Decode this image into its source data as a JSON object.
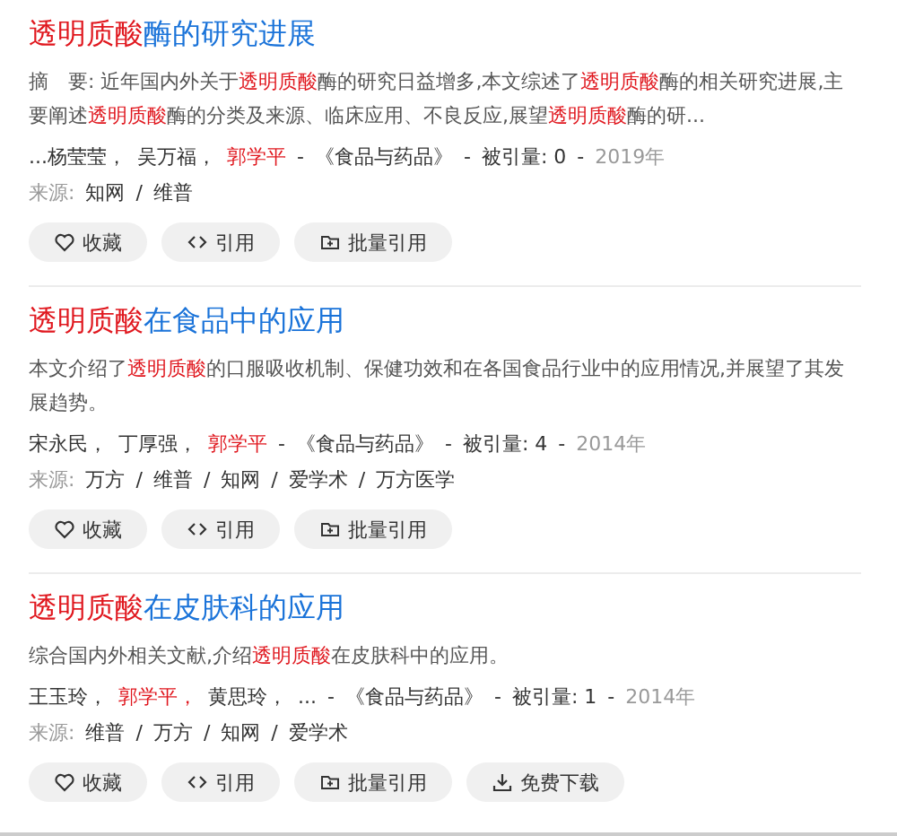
{
  "results": [
    {
      "title_highlight": "透明质酸",
      "title_rest": "酶的研究进展",
      "abstract": "摘　要: 近年国内外关于**透明质酸**酶的研究日益增多,本文综述了**透明质酸**酶的相关研究进展,主要阐述**透明质酸**酶的分类及来源、临床应用、不良反应,展望**透明质酸**酶的研...",
      "meta": [
        {
          "kind": "author",
          "text": "...杨莹莹，",
          "highlighted": false
        },
        {
          "kind": "author",
          "text": "吴万福，",
          "highlighted": false
        },
        {
          "kind": "author",
          "text": "郭学平",
          "highlighted": true
        },
        {
          "kind": "sep",
          "text": "-"
        },
        {
          "kind": "journal",
          "text": "《食品与药品》"
        },
        {
          "kind": "sep",
          "text": "-"
        },
        {
          "kind": "cite",
          "text": "被引量: 0"
        },
        {
          "kind": "sep",
          "text": "-"
        },
        {
          "kind": "year",
          "text": "2019年"
        }
      ],
      "source_label": "来源:",
      "source_separator": "/",
      "sources": [
        "知网",
        "维普"
      ],
      "actions": [
        {
          "kind": "heart",
          "label": "收藏"
        },
        {
          "kind": "code",
          "label": "引用"
        },
        {
          "kind": "folder",
          "label": "批量引用"
        }
      ]
    },
    {
      "title_highlight": "透明质酸",
      "title_rest": "在食品中的应用",
      "abstract": "本文介绍了**透明质酸**的口服吸收机制、保健功效和在各国食品行业中的应用情况,并展望了其发展趋势。",
      "meta": [
        {
          "kind": "author",
          "text": "宋永民，",
          "highlighted": false
        },
        {
          "kind": "author",
          "text": "丁厚强，",
          "highlighted": false
        },
        {
          "kind": "author",
          "text": "郭学平",
          "highlighted": true
        },
        {
          "kind": "sep",
          "text": "-"
        },
        {
          "kind": "journal",
          "text": "《食品与药品》"
        },
        {
          "kind": "sep",
          "text": "-"
        },
        {
          "kind": "cite",
          "text": "被引量: 4"
        },
        {
          "kind": "sep",
          "text": "-"
        },
        {
          "kind": "year",
          "text": "2014年"
        }
      ],
      "source_label": "来源:",
      "source_separator": "/",
      "sources": [
        "万方",
        "维普",
        "知网",
        "爱学术",
        "万方医学"
      ],
      "actions": [
        {
          "kind": "heart",
          "label": "收藏"
        },
        {
          "kind": "code",
          "label": "引用"
        },
        {
          "kind": "folder",
          "label": "批量引用"
        }
      ]
    },
    {
      "title_highlight": "透明质酸",
      "title_rest": "在皮肤科的应用",
      "abstract": "综合国内外相关文献,介绍**透明质酸**在皮肤科中的应用。",
      "meta": [
        {
          "kind": "author",
          "text": "王玉玲，",
          "highlighted": false
        },
        {
          "kind": "author",
          "text": "郭学平，",
          "highlighted": true
        },
        {
          "kind": "author",
          "text": "黄思玲，",
          "highlighted": false
        },
        {
          "kind": "author",
          "text": "...",
          "highlighted": false
        },
        {
          "kind": "sep",
          "text": "-"
        },
        {
          "kind": "journal",
          "text": "《食品与药品》"
        },
        {
          "kind": "sep",
          "text": "-"
        },
        {
          "kind": "cite",
          "text": "被引量: 1"
        },
        {
          "kind": "sep",
          "text": "-"
        },
        {
          "kind": "year",
          "text": "2014年"
        }
      ],
      "source_label": "来源:",
      "source_separator": "/",
      "sources": [
        "维普",
        "万方",
        "知网",
        "爱学术"
      ],
      "actions": [
        {
          "kind": "heart",
          "label": "收藏"
        },
        {
          "kind": "code",
          "label": "引用"
        },
        {
          "kind": "folder",
          "label": "批量引用"
        },
        {
          "kind": "download",
          "label": "免费下载"
        }
      ]
    }
  ]
}
